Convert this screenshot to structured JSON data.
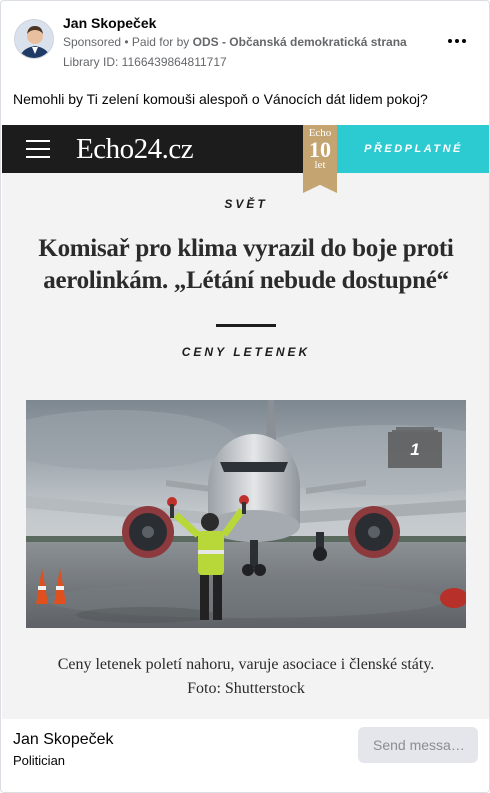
{
  "post": {
    "author": "Jan Skopeček",
    "sponsored": "Sponsored",
    "separator": " • ",
    "paid_for_prefix": "Paid for by ",
    "paid_for_by": "ODS - Občanská demokratická strana",
    "library_id": "Library ID: 1166439864811717",
    "more_icon": "more-options-icon",
    "text": "Nemohli by Ti zelení komouši alespoň o Vánocích dát lidem pokoj?"
  },
  "creative": {
    "logo": "Echo24.cz",
    "anniversary": {
      "line1": "Echo",
      "line2": "10",
      "line3": "let"
    },
    "subscribe": "PŘEDPLATNÉ",
    "section": "SVĚT",
    "headline": "Komisař pro klima vyrazil do boje proti aerolinkám. „Létání nebude dostupné“",
    "tag": "CENY LETENEK",
    "gallery_count": "1",
    "caption_line1": "Ceny letenek poletí nahoru, varuje asociace i členské státy.",
    "caption_line2": "Foto: Shutterstock",
    "colors": {
      "bar": "#1c1c1c",
      "accent": "#2ccbd2",
      "ribbon": "#c4a571"
    }
  },
  "footer": {
    "name": "Jan Skopeček",
    "role": "Politician",
    "send_button": "Send messa…"
  }
}
